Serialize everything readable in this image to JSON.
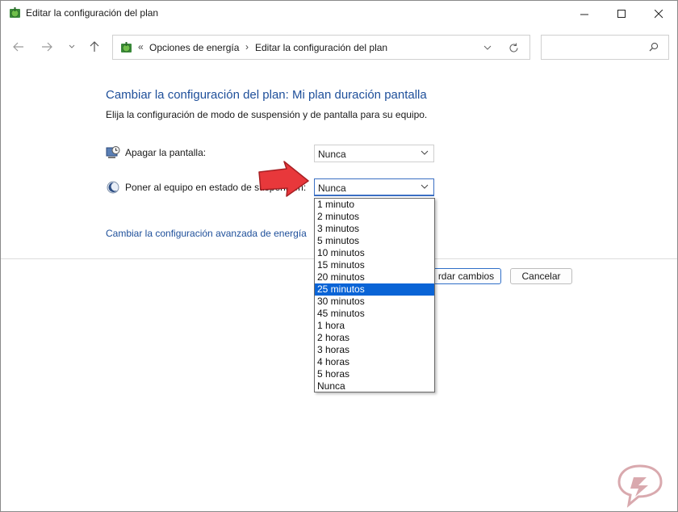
{
  "window": {
    "title": "Editar la configuración del plan"
  },
  "address_bar": {
    "prefix": "«",
    "crumbs": [
      "Opciones de energía",
      "Editar la configuración del plan"
    ],
    "separator": "›"
  },
  "search": {
    "placeholder": ""
  },
  "content": {
    "heading": "Cambiar la configuración del plan: Mi plan duración pantalla",
    "subtext": "Elija la configuración de modo de suspensión y de pantalla para su equipo.",
    "display_label": "Apagar la pantalla:",
    "display_value": "Nunca",
    "sleep_label": "Poner al equipo en estado de suspensión:",
    "sleep_value": "Nunca",
    "advanced_link": "Cambiar la configuración avanzada de energía"
  },
  "buttons": {
    "save": "Guardar cambios",
    "save_visible": "rdar cambios",
    "cancel": "Cancelar"
  },
  "dropdown": {
    "options": [
      "1 minuto",
      "2 minutos",
      "3 minutos",
      "5 minutos",
      "10 minutos",
      "15 minutos",
      "20 minutos",
      "25 minutos",
      "30 minutos",
      "45 minutos",
      "1 hora",
      "2 horas",
      "3 horas",
      "4 horas",
      "5 horas",
      "Nunca"
    ],
    "highlighted": "25 minutos"
  },
  "colors": {
    "link": "#1e4f9a",
    "highlight": "#0a64d6",
    "arrow": "#e8383b"
  }
}
